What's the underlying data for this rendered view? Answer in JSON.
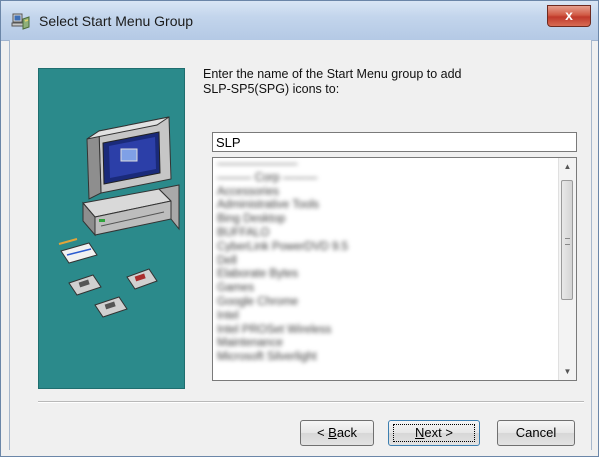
{
  "window": {
    "title": "Select Start Menu Group",
    "close_label": "x"
  },
  "prompt": {
    "line1": "Enter the name of the Start Menu group to add",
    "line2": "SLP-SP5(SPG) icons to:"
  },
  "group_input": {
    "value": "SLP"
  },
  "program_groups": [
    "———————",
    "——— Corp ———",
    "Accessories",
    "Administrative Tools",
    "Bing Desktop",
    "BUFFALO",
    "CyberLink PowerDVD 9.5",
    "Dell",
    "Elaborate Bytes",
    "Games",
    "Google Chrome",
    "Intel",
    "Intel PROSet Wireless",
    "Maintenance",
    "Microsoft Silverlight"
  ],
  "buttons": {
    "back_pre": "< ",
    "back_key": "B",
    "back_post": "ack",
    "next_key": "N",
    "next_post": "ext >",
    "cancel": "Cancel"
  },
  "colors": {
    "art_panel_bg": "#2b8a8b",
    "close_button": "#c0392b"
  }
}
